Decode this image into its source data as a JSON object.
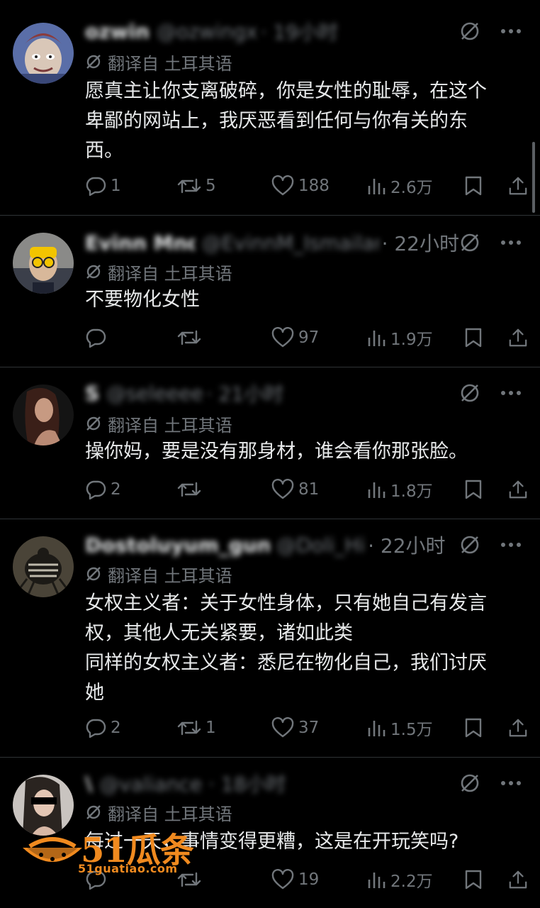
{
  "posts": [
    {
      "name": "ozwin",
      "handle": "@ozwingx",
      "time": "· 19小时",
      "translated": "翻译自 土耳其语",
      "text": "愿真主让你支离破碎，你是女性的耻辱，在这个\n卑鄙的网站上，我厌恶看到任何与你有关的东\n西。",
      "replies": "1",
      "reposts": "5",
      "likes": "188",
      "views": "2.6万"
    },
    {
      "name": "Evinn Mnd",
      "handle": "@EvinnM_Ismailart",
      "time": "· 22小时",
      "translated": "翻译自 土耳其语",
      "text": "不要物化女性",
      "replies": "",
      "reposts": "",
      "likes": "97",
      "views": "1.9万"
    },
    {
      "name": "S",
      "handle": "@seleeee",
      "time": "· 21小时",
      "translated": "翻译自 土耳其语",
      "text": "操你妈，要是没有那身材，谁会看你那张脸。",
      "replies": "2",
      "reposts": "",
      "likes": "81",
      "views": "1.8万"
    },
    {
      "name": "Dostoluyum_gunes",
      "handle": "@Doli_Hi",
      "time": "· 22小时",
      "translated": "翻译自 土耳其语",
      "text": "女权主义者：关于女性身体，只有她自己有发言\n权，其他人无关紧要，诸如此类\n同样的女权主义者：悉尼在物化自己，我们讨厌\n她",
      "replies": "2",
      "reposts": "1",
      "likes": "37",
      "views": "1.5万"
    },
    {
      "name": "\\",
      "handle": "@valiance · 18小时",
      "time": "",
      "translated": "翻译自 土耳其语",
      "text": "每过一天，事情变得更糟，这是在开玩笑吗?",
      "replies": "",
      "reposts": "",
      "likes": "19",
      "views": "2.2万"
    }
  ],
  "icons": {
    "header": [
      "grok-icon",
      "more-icon"
    ],
    "actions": [
      "reply-icon",
      "repost-icon",
      "like-icon",
      "views-icon",
      "bookmark-icon",
      "share-icon"
    ]
  },
  "watermark": {
    "brand": "51瓜条",
    "url": "51guatiao.com"
  },
  "colors": {
    "background": "#000000",
    "text": "#e7e9ea",
    "secondary": "#71767b",
    "divider": "#2f3336",
    "watermark": "#f08a1f"
  }
}
